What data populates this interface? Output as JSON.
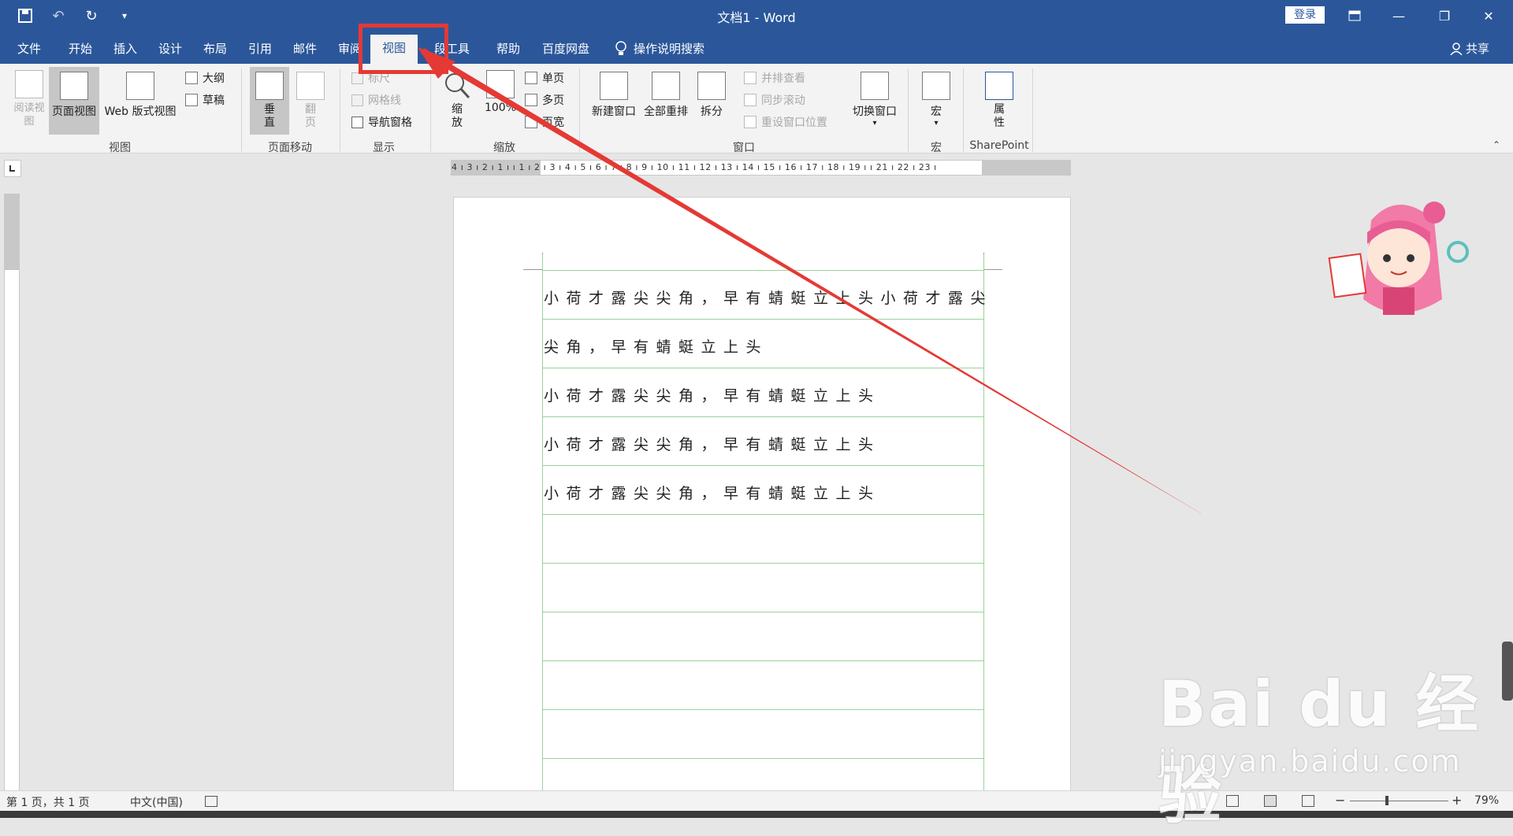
{
  "titlebar": {
    "title": "文档1 - Word",
    "login": "登录"
  },
  "tabs": {
    "file": "文件",
    "home": "开始",
    "insert": "插入",
    "design": "设计",
    "layout": "布局",
    "references": "引用",
    "mailings": "邮件",
    "review": "审阅",
    "view": "视图",
    "tools": "段工具",
    "help": "帮助",
    "baidu": "百度网盘",
    "tellme": "操作说明搜索",
    "share": "共享"
  },
  "ribbon": {
    "read_mode": "阅读视图",
    "print_layout": "页面视图",
    "web_layout": "Web 版式视图",
    "outline": "大纲",
    "draft": "草稿",
    "group_views": "视图",
    "vertical": "垂直",
    "side_to_side": "翻页",
    "group_page_movement": "页面移动",
    "ruler": "标尺",
    "gridlines": "网格线",
    "nav_pane": "导航窗格",
    "group_show": "显示",
    "zoom": "缩放",
    "zoom100": "100%",
    "one_page": "单页",
    "multiple_pages": "多页",
    "page_width": "页宽",
    "group_zoom": "缩放",
    "new_window": "新建窗口",
    "arrange_all": "全部重排",
    "split": "拆分",
    "view_side_by_side": "并排查看",
    "sync_scroll": "同步滚动",
    "reset_position": "重设窗口位置",
    "switch_windows": "切换窗口",
    "group_window": "窗口",
    "macros": "宏",
    "group_macros": "宏",
    "properties": "属性",
    "group_sharepoint": "SharePoint"
  },
  "ruler": {
    "labels": "4 ı 3 ı 2 ı 1 ı   ı 1 ı 2 ı 3 ı 4 ı 5 ı 6 ı 7 ı 8 ı 9 ı 10 ı 11 ı 12 ı 13 ı 14 ı 15 ı 16 ı 17 ı 18 ı 19 ı   ı 21 ı 22 ı 23 ı"
  },
  "document": {
    "lines": [
      "小荷才露尖尖角，早有蜻蜓立上头小荷才露尖",
      "尖角，早有蜻蜓立上头",
      "小荷才露尖尖角，早有蜻蜓立上头",
      "小荷才露尖尖角，早有蜻蜓立上头",
      "小荷才露尖尖角，早有蜻蜓立上头"
    ]
  },
  "statusbar": {
    "page": "第 1 页，共 1 页",
    "language": "中文(中国)",
    "zoom": "79%"
  },
  "watermark": {
    "main": "Bai du 经验",
    "sub": "jingyan.baidu.com"
  },
  "colors": {
    "accent": "#2b579a",
    "highlight": "#e53935",
    "grid_line": "#9ad39a"
  }
}
